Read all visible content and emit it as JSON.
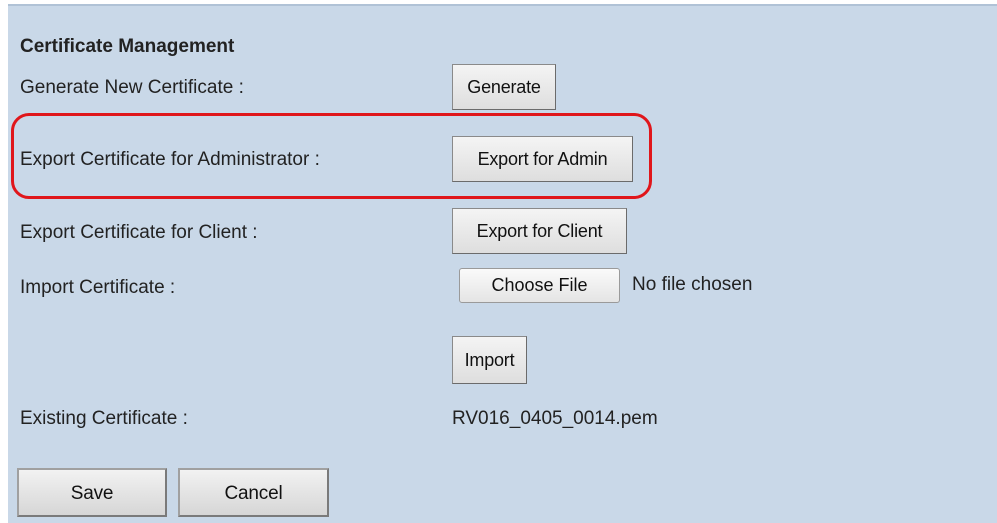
{
  "section_title": "Certificate Management",
  "rows": {
    "generate": {
      "label": "Generate New Certificate :",
      "button": "Generate"
    },
    "export_admin": {
      "label": "Export Certificate for Administrator :",
      "button": "Export for Admin"
    },
    "export_client": {
      "label": "Export Certificate for Client :",
      "button": "Export for Client"
    },
    "import": {
      "label": "Import Certificate :",
      "choose_button": "Choose File",
      "file_status": "No file chosen",
      "import_button": "Import"
    },
    "existing": {
      "label": "Existing Certificate :",
      "value": "RV016_0405_0014.pem"
    }
  },
  "actions": {
    "save_label": "Save",
    "cancel_label": "Cancel"
  },
  "colors": {
    "panel_background": "#c9d8e8",
    "highlight": "#e0161b"
  }
}
